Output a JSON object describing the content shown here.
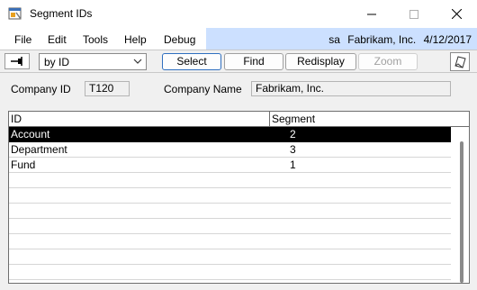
{
  "window": {
    "title": "Segment IDs"
  },
  "menu": {
    "items": [
      "File",
      "Edit",
      "Tools",
      "Help",
      "Debug"
    ],
    "user": "sa",
    "company": "Fabrikam, Inc.",
    "date": "4/12/2017"
  },
  "toolbar": {
    "sort_value": "by ID",
    "select_label": "Select",
    "find_label": "Find",
    "redisplay_label": "Redisplay",
    "zoom_label": "Zoom"
  },
  "fields": {
    "company_id_label": "Company ID",
    "company_id_value": "T120",
    "company_name_label": "Company Name",
    "company_name_value": "Fabrikam, Inc."
  },
  "grid": {
    "columns": [
      "ID",
      "Segment"
    ],
    "rows": [
      {
        "id": "Account",
        "segment": "2"
      },
      {
        "id": "Department",
        "segment": "3"
      },
      {
        "id": "Fund",
        "segment": "1"
      }
    ]
  },
  "colors": {
    "menu_highlight": "#cce0ff",
    "selected_row_bg": "#000000",
    "selected_row_fg": "#ffffff",
    "primary_button_border": "#2f6fbf"
  }
}
